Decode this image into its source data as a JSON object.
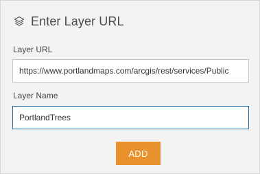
{
  "dialog": {
    "title": "Enter Layer URL",
    "title_icon": "layers-icon"
  },
  "form": {
    "url_label": "Layer URL",
    "url_value": "https://www.portlandmaps.com/arcgis/rest/services/Public",
    "name_label": "Layer Name",
    "name_value": "PortlandTrees",
    "add_label": "ADD"
  },
  "colors": {
    "accent_button": "#e8912d",
    "focus_border": "#1d6fb0",
    "panel_background": "#f3f3f3"
  }
}
